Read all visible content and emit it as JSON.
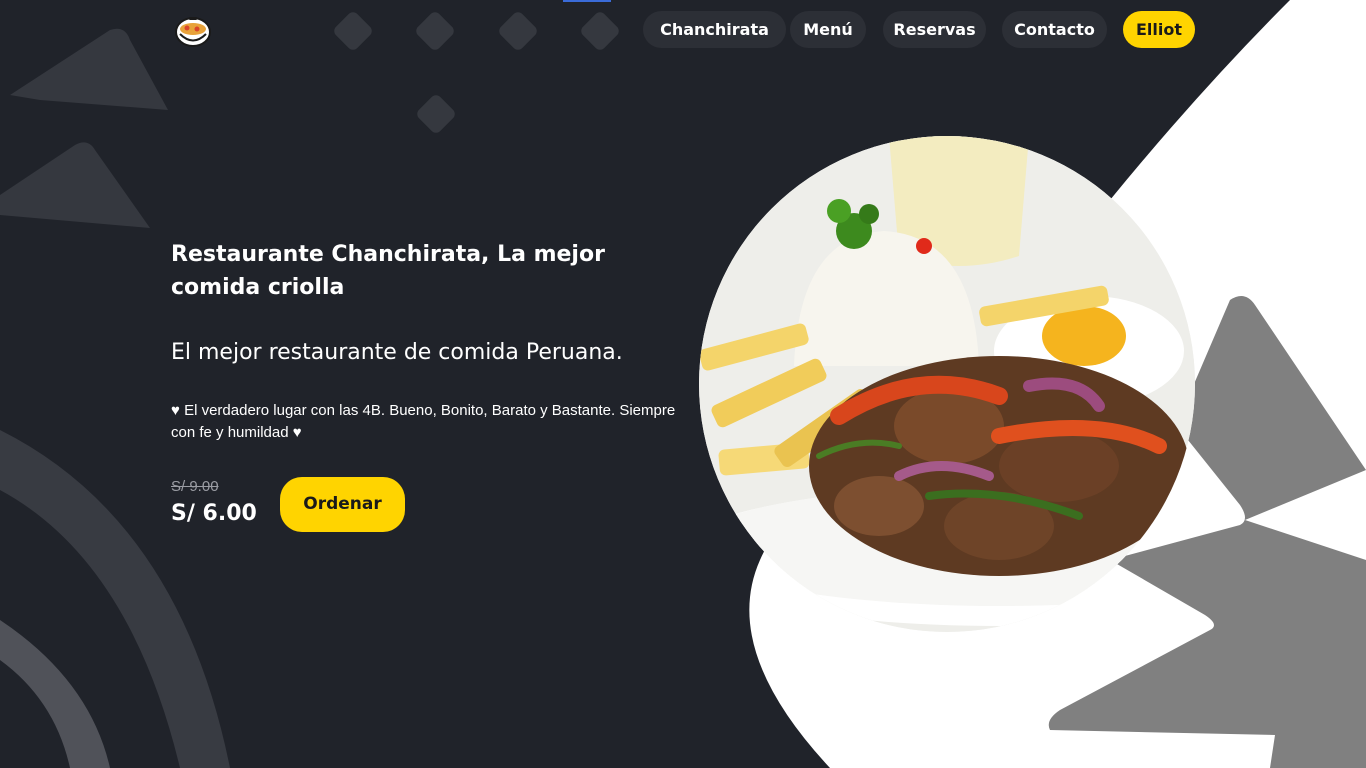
{
  "nav": {
    "items": [
      {
        "label": "Chanchirata"
      },
      {
        "label": "Menú"
      },
      {
        "label": "Reservas"
      },
      {
        "label": "Contacto"
      }
    ],
    "user_label": "Elliot"
  },
  "hero": {
    "title": "Restaurante Chanchirata, La mejor comida criolla",
    "subtitle": "El mejor restaurante de comida Peruana.",
    "description": "♥ El verdadero lugar con las 4B. Bueno, Bonito, Barato y Bastante. Siempre con fe y humildad ♥",
    "price_old": "S/ 9.00",
    "price_new": "S/ 6.00",
    "order_label": "Ordenar"
  },
  "colors": {
    "background": "#20232a",
    "accent": "#ffd400",
    "nav_pill": "#2c2f36"
  },
  "icons": {
    "logo": "soup-bowl-icon"
  }
}
